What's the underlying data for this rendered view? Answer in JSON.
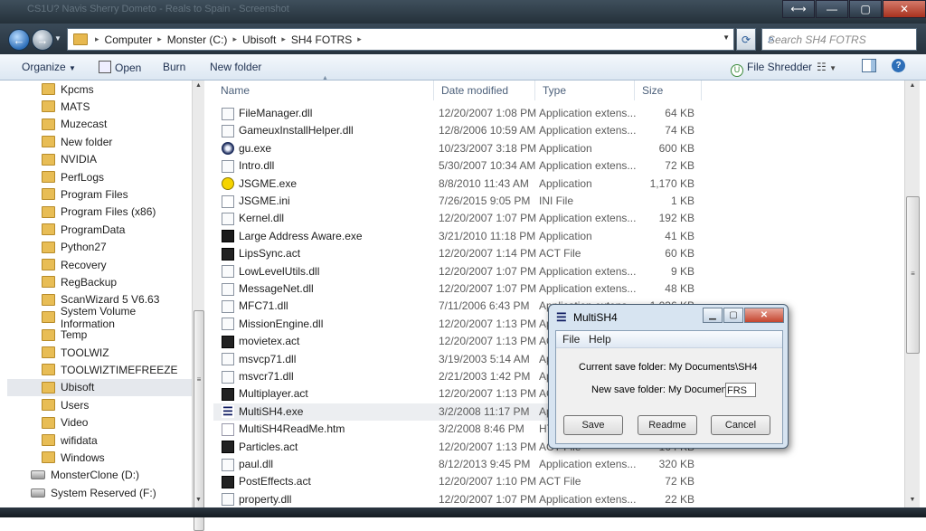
{
  "window": {
    "ghost_title": "CS1U? Navis Sherry Dometo - Reals to Spain - Screenshot",
    "snap_label": "⟷",
    "min_label": "—",
    "max_label": "▢",
    "close_label": "✕"
  },
  "address": {
    "crumbs": [
      "Computer",
      "Monster (C:)",
      "Ubisoft",
      "SH4 FOTRS"
    ],
    "search_placeholder": "Search SH4 FOTRS"
  },
  "toolbar": {
    "organize": "Organize",
    "open": "Open",
    "burn": "Burn",
    "new_folder": "New folder",
    "file_shredder": "File Shredder"
  },
  "sidebar": {
    "folders": [
      "Kpcms",
      "MATS",
      "Muzecast",
      "New folder",
      "NVIDIA",
      "PerfLogs",
      "Program Files",
      "Program Files (x86)",
      "ProgramData",
      "Python27",
      "Recovery",
      "RegBackup",
      "ScanWizard 5 V6.63",
      "System Volume Information",
      "Temp",
      "TOOLWIZ",
      "TOOLWIZTIMEFREEZE",
      "Ubisoft",
      "Users",
      "Video",
      "wifidata",
      "Windows"
    ],
    "selected": "Ubisoft",
    "drives": [
      "MonsterClone (D:)",
      "System Reserved (F:)"
    ]
  },
  "columns": {
    "name": "Name",
    "date": "Date modified",
    "type": "Type",
    "size": "Size"
  },
  "files": [
    {
      "name": "FileManager.dll",
      "date": "12/20/2007 1:08 PM",
      "type": "Application extens...",
      "size": "64 KB",
      "icon": "dll"
    },
    {
      "name": "GameuxInstallHelper.dll",
      "date": "12/8/2006 10:59 AM",
      "type": "Application extens...",
      "size": "74 KB",
      "icon": "dll"
    },
    {
      "name": "gu.exe",
      "date": "10/23/2007 3:18 PM",
      "type": "Application",
      "size": "600 KB",
      "icon": "gu"
    },
    {
      "name": "Intro.dll",
      "date": "5/30/2007 10:34 AM",
      "type": "Application extens...",
      "size": "72 KB",
      "icon": "dll"
    },
    {
      "name": "JSGME.exe",
      "date": "8/8/2010 11:43 AM",
      "type": "Application",
      "size": "1,170 KB",
      "icon": "jsg"
    },
    {
      "name": "JSGME.ini",
      "date": "7/26/2015 9:05 PM",
      "type": "INI File",
      "size": "1 KB",
      "icon": "ini"
    },
    {
      "name": "Kernel.dll",
      "date": "12/20/2007 1:07 PM",
      "type": "Application extens...",
      "size": "192 KB",
      "icon": "dll"
    },
    {
      "name": "Large Address Aware.exe",
      "date": "3/21/2010 11:18 PM",
      "type": "Application",
      "size": "41 KB",
      "icon": "laa"
    },
    {
      "name": "LipsSync.act",
      "date": "12/20/2007 1:14 PM",
      "type": "ACT File",
      "size": "60 KB",
      "icon": "act"
    },
    {
      "name": "LowLevelUtils.dll",
      "date": "12/20/2007 1:07 PM",
      "type": "Application extens...",
      "size": "9 KB",
      "icon": "dll"
    },
    {
      "name": "MessageNet.dll",
      "date": "12/20/2007 1:07 PM",
      "type": "Application extens...",
      "size": "48 KB",
      "icon": "dll"
    },
    {
      "name": "MFC71.dll",
      "date": "7/11/2006 6:43 PM",
      "type": "Application extens...",
      "size": "1,036 KB",
      "icon": "dll"
    },
    {
      "name": "MissionEngine.dll",
      "date": "12/20/2007 1:13 PM",
      "type": "Application extens...",
      "size": "",
      "icon": "dll"
    },
    {
      "name": "movietex.act",
      "date": "12/20/2007 1:13 PM",
      "type": "ACT File",
      "size": "",
      "icon": "act"
    },
    {
      "name": "msvcp71.dll",
      "date": "3/19/2003 5:14 AM",
      "type": "Application extens...",
      "size": "",
      "icon": "dll"
    },
    {
      "name": "msvcr71.dll",
      "date": "2/21/2003 1:42 PM",
      "type": "Application extens...",
      "size": "",
      "icon": "dll"
    },
    {
      "name": "Multiplayer.act",
      "date": "12/20/2007 1:13 PM",
      "type": "ACT File",
      "size": "",
      "icon": "act"
    },
    {
      "name": "MultiSH4.exe",
      "date": "3/2/2008 11:17 PM",
      "type": "Application",
      "size": "",
      "icon": "msh"
    },
    {
      "name": "MultiSH4ReadMe.htm",
      "date": "3/2/2008 8:46 PM",
      "type": "HTML Document",
      "size": "",
      "icon": "html"
    },
    {
      "name": "Particles.act",
      "date": "12/20/2007 1:13 PM",
      "type": "ACT File",
      "size": "164 KB",
      "icon": "act"
    },
    {
      "name": "paul.dll",
      "date": "8/12/2013 9:45 PM",
      "type": "Application extens...",
      "size": "320 KB",
      "icon": "dll"
    },
    {
      "name": "PostEffects.act",
      "date": "12/20/2007 1:10 PM",
      "type": "ACT File",
      "size": "72 KB",
      "icon": "act"
    },
    {
      "name": "property.dll",
      "date": "12/20/2007 1:07 PM",
      "type": "Application extens...",
      "size": "22 KB",
      "icon": "dll"
    }
  ],
  "selected_file": "MultiSH4.exe",
  "dialog": {
    "title": "MultiSH4",
    "menu_file": "File",
    "menu_help": "Help",
    "current_label": "Current save folder: My Documents\\SH4",
    "new_label": "New save folder: My Documents\\",
    "new_value": "FRS",
    "save": "Save",
    "readme": "Readme",
    "cancel": "Cancel"
  },
  "colors": {
    "accent": "#2e6fb8",
    "selection": "#e5e8ed",
    "folder": "#e8bd55"
  }
}
